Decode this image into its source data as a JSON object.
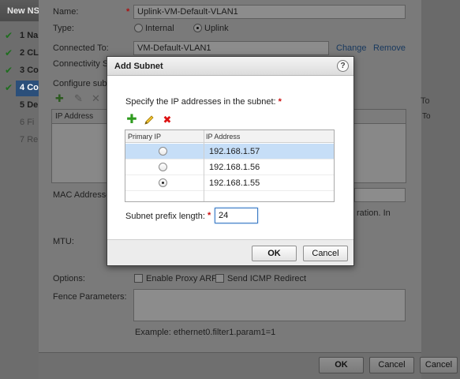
{
  "outer": {
    "title": "New NS",
    "steps": [
      {
        "num": "1",
        "label": "Na",
        "done": true
      },
      {
        "num": "2",
        "label": "CL",
        "done": true
      },
      {
        "num": "3",
        "label": "Co",
        "done": true
      },
      {
        "num": "4",
        "label": "Co",
        "done": true,
        "current": true
      },
      {
        "num": "5",
        "label": "De",
        "done": false
      },
      {
        "num": "6",
        "label": "Fi",
        "done": false
      },
      {
        "num": "7",
        "label": "Re",
        "done": false
      }
    ],
    "name_label": "Name:",
    "name_value": "Uplink-VM-Default-VLAN1",
    "type_label": "Type:",
    "type_internal": "Internal",
    "type_uplink": "Uplink",
    "connected_label": "Connected To:",
    "connected_value": "VM-Default-VLAN1",
    "change_link": "Change",
    "remove_link": "Remove",
    "connectivity_label": "Connectivity St",
    "configure_label": "Configure subn",
    "table_ip_header": "IP Address",
    "table_right_header": "To",
    "mac_label": "MAC Addresse",
    "mac_note": "ration. In",
    "mtu_label": "MTU:",
    "options_label": "Options:",
    "enable_proxy_arp": "Enable Proxy ARP",
    "send_icmp_redirect": "Send ICMP Redirect",
    "fence_label": "Fence Parameters:",
    "fence_example": "Example: ethernet0.filter1.param1=1",
    "ok": "OK",
    "cancel": "Cancel",
    "cancel_right": "Cancel"
  },
  "dialog": {
    "title": "Add Subnet",
    "help": "?",
    "instruction": "Specify the IP addresses in the subnet:",
    "required_mark": "*",
    "columns": [
      "Primary IP",
      "IP Address"
    ],
    "rows": [
      {
        "ip": "192.168.1.57",
        "primary": false,
        "selected": true
      },
      {
        "ip": "192.168.1.56",
        "primary": false,
        "selected": false
      },
      {
        "ip": "192.168.1.55",
        "primary": true,
        "selected": false
      }
    ],
    "prefix_label": "Subnet prefix length:",
    "prefix_value": "24",
    "ok": "OK",
    "cancel": "Cancel"
  },
  "icons": {
    "add": "plus-icon",
    "edit": "pencil-icon",
    "delete": "x-icon",
    "help": "question-icon",
    "check": "checkmark-icon"
  },
  "colors": {
    "selected_row": "#c6def7",
    "add_icon": "#2f9b1f",
    "delete_icon": "#dd1111",
    "required": "#cc1111",
    "current_step": "#2b4f7a"
  }
}
